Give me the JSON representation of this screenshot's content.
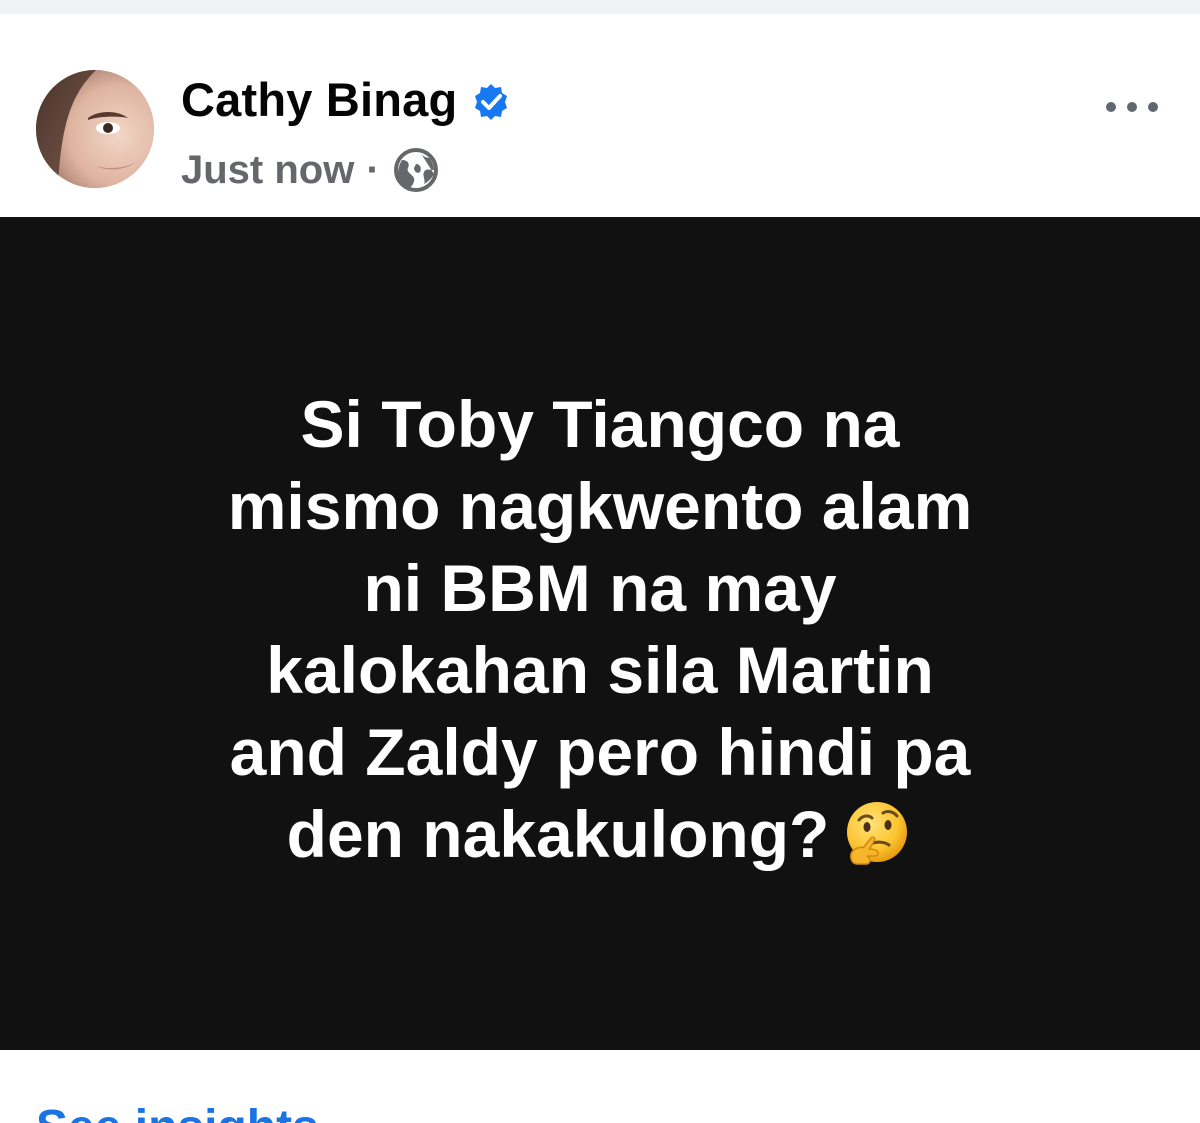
{
  "post": {
    "author": {
      "name": "Cathy Binag",
      "verified": true
    },
    "timestamp": "Just now",
    "separator": "·",
    "privacy_icon": "globe-icon",
    "more_icon": "more-horizontal-icon",
    "body": {
      "background": "#111111",
      "text_color": "#ffffff",
      "lines": [
        "Si Toby Tiangco na",
        "mismo nagkwento alam",
        "ni BBM na may",
        "kalokahan sila Martin",
        "and Zaldy pero hindi pa",
        "den nakakulong?"
      ],
      "emoji": "thinking-face-emoji"
    },
    "footer_link": "See insights"
  },
  "colors": {
    "verified_blue": "#1877f2",
    "secondary_text": "#65676b",
    "link_blue": "#1b74e4"
  }
}
